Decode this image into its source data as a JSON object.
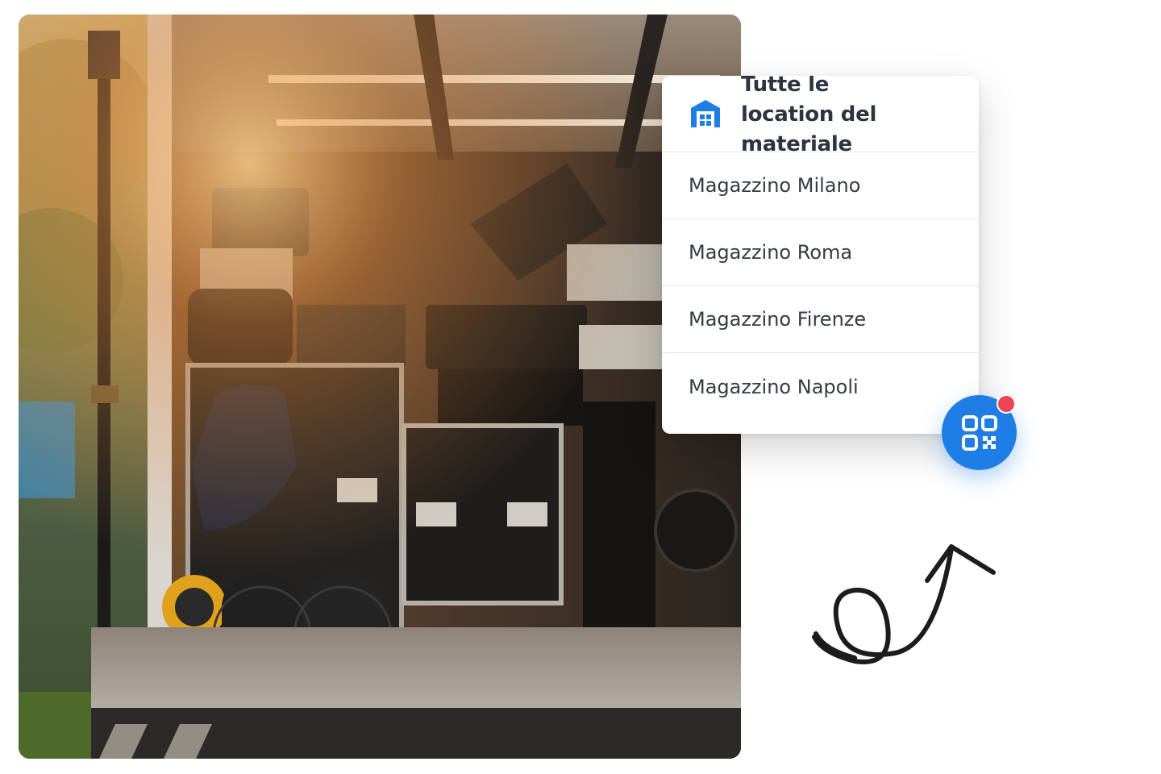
{
  "photo": {
    "subject": "event-equipment-truck"
  },
  "location_card": {
    "icon": "warehouse-icon",
    "title": "Tutte le location del materiale",
    "items": [
      {
        "label": "Magazzino Milano"
      },
      {
        "label": "Magazzino Roma"
      },
      {
        "label": "Magazzino Firenze"
      },
      {
        "label": "Magazzino Napoli"
      }
    ]
  },
  "qr_button": {
    "icon": "qr-code-icon",
    "has_notification": true
  },
  "colors": {
    "accent": "#1f7ee6",
    "notification": "#ef4453",
    "text_primary": "#2c3440",
    "text_item": "#353b45",
    "divider": "#e3e6ea"
  }
}
